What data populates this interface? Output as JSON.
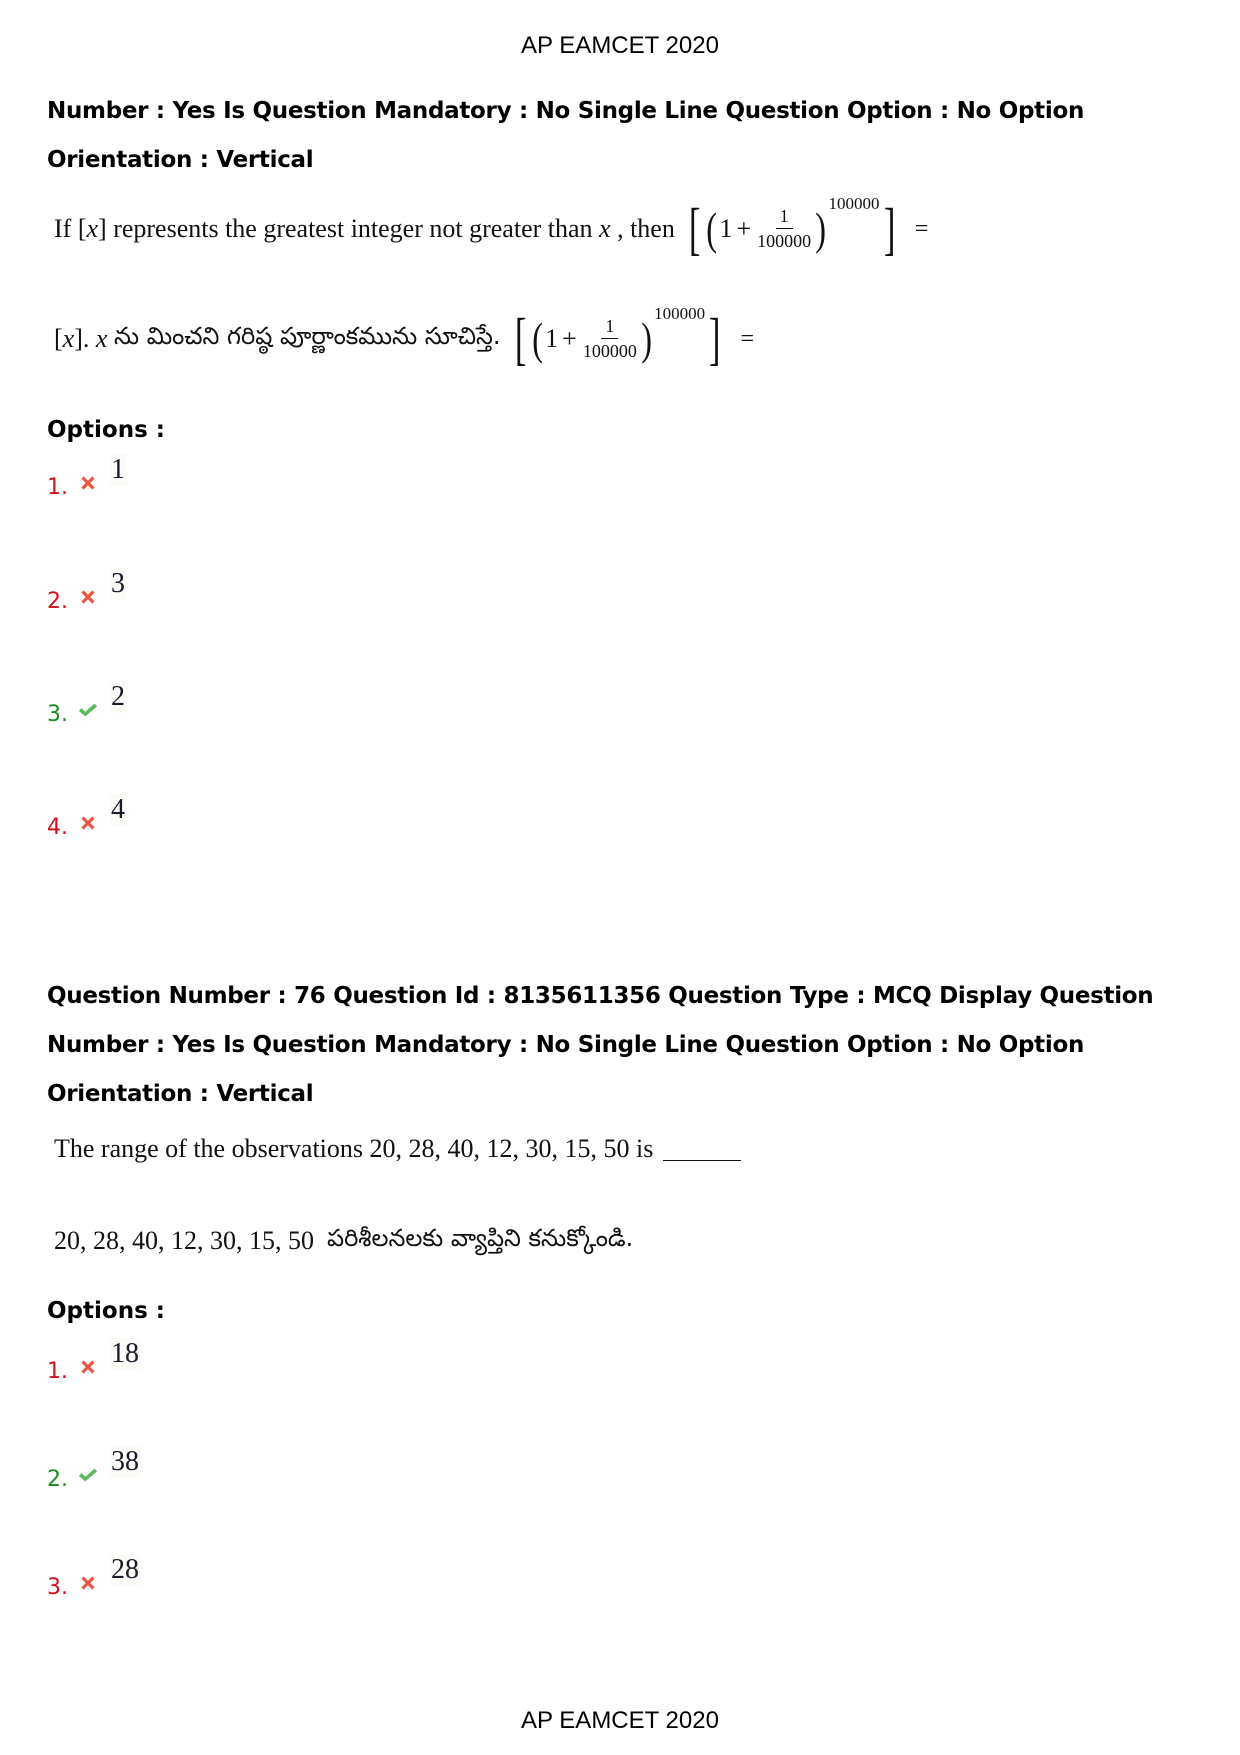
{
  "header": {
    "title": "AP EAMCET 2020"
  },
  "footer": {
    "title": "AP EAMCET 2020"
  },
  "question_75": {
    "meta_line_1": "Number : Yes Is Question Mandatory : No Single Line Question Option : No Option",
    "meta_line_2": "Orientation : Vertical",
    "english": {
      "prefix": "If [",
      "var": "x",
      "mid": "] represents the greatest integer not greater than",
      "var2": "x",
      "suffix": ", then"
    },
    "telugu": {
      "prefix": "[",
      "var": "x",
      "mid": "].",
      "var2": "x",
      "text": "ను మించని గరిష్ఠ పూర్ణాంకమును సూచిస్తే."
    },
    "math": {
      "one": "1",
      "plus": "+",
      "numerator": "1",
      "denominator": "100000",
      "exponent": "100000",
      "equals": "="
    },
    "options_label": "Options :",
    "options": [
      {
        "number": "1.",
        "value": "1",
        "status": "wrong",
        "icon": "cross-icon"
      },
      {
        "number": "2.",
        "value": "3",
        "status": "wrong",
        "icon": "cross-icon"
      },
      {
        "number": "3.",
        "value": "2",
        "status": "correct",
        "icon": "check-icon"
      },
      {
        "number": "4.",
        "value": "4",
        "status": "wrong",
        "icon": "cross-icon"
      }
    ]
  },
  "question_76": {
    "meta_line_1": "Question Number : 76 Question Id : 8135611356 Question Type : MCQ Display Question",
    "meta_line_2": "Number : Yes Is Question Mandatory : No Single Line Question Option : No Option",
    "meta_line_3": "Orientation : Vertical",
    "english": "The range of the observations 20, 28, 40, 12, 30, 15, 50 is",
    "telugu_numbers": "20, 28, 40, 12, 30, 15, 50",
    "telugu_text": "పరిశీలనలకు వ్యాప్తిని కనుక్కోండి.",
    "options_label": "Options :",
    "options": [
      {
        "number": "1.",
        "value": "18",
        "status": "wrong",
        "icon": "cross-icon"
      },
      {
        "number": "2.",
        "value": "38",
        "status": "correct",
        "icon": "check-icon"
      },
      {
        "number": "3.",
        "value": "28",
        "status": "wrong",
        "icon": "cross-icon"
      }
    ]
  },
  "colors": {
    "wrong": "#d0121b",
    "correct": "#1a8a1a",
    "cross_icon": "#e8563f",
    "check_icon": "#5cb85c"
  }
}
